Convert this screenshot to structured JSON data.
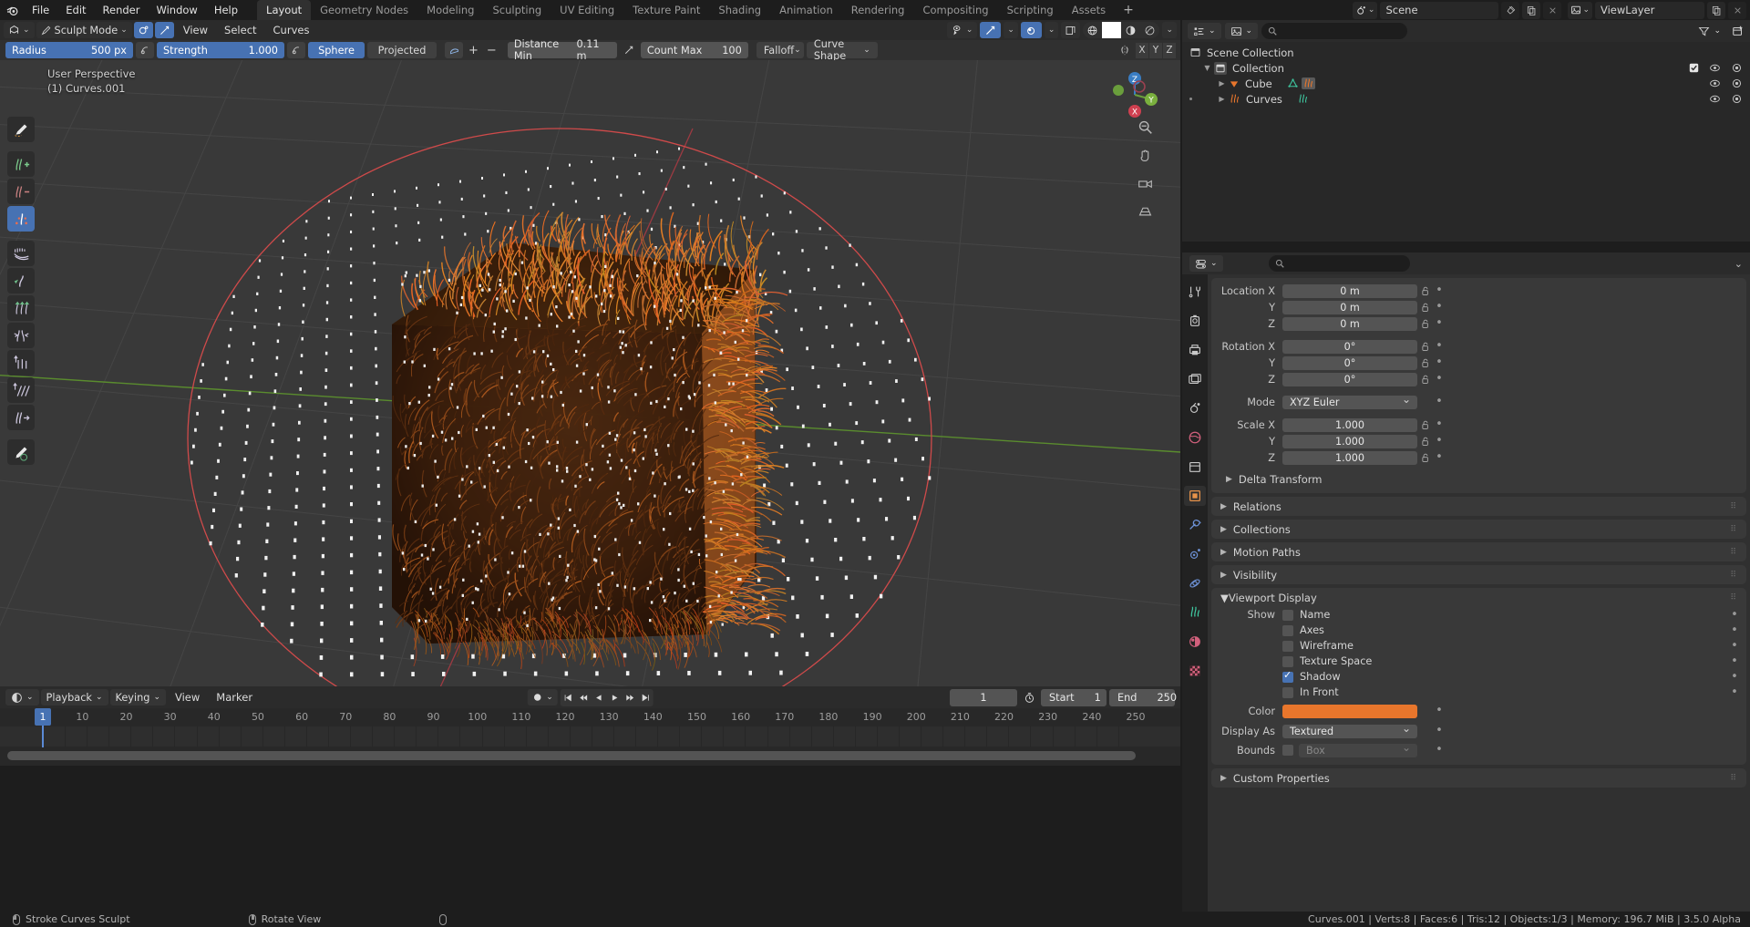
{
  "app": {
    "title": "Blender",
    "logo_icon": "blender-logo-icon"
  },
  "topbar": {
    "menus": [
      "File",
      "Edit",
      "Render",
      "Window",
      "Help"
    ],
    "tabs": [
      "Layout",
      "Geometry Nodes",
      "Modeling",
      "Sculpting",
      "UV Editing",
      "Texture Paint",
      "Shading",
      "Animation",
      "Rendering",
      "Compositing",
      "Scripting",
      "Assets"
    ],
    "active_tab": "Layout",
    "add_workspace_label": "+",
    "scene_icon": "scene-icon",
    "scene_name": "Scene",
    "pin_icon": "pin-icon",
    "copy_icon": "copy-icon",
    "close_icon": "close-icon",
    "viewlayer_icon": "viewlayer-icon",
    "viewlayer_name": "ViewLayer"
  },
  "viewport_header": {
    "editor_type_icon": "editor-type-icon",
    "mode": "Sculpt Mode",
    "toggle_icons": [
      "curves-sculpt-toggle-icon",
      "annotate-icon"
    ],
    "menus": [
      "View",
      "Select",
      "Curves"
    ],
    "right_controls": {
      "visibility_icon": "object-visibility-icon",
      "snap_icon": "snap-magnet-icon",
      "proportional_icon": "proportional-editing-icon",
      "overlay_toggle_icon": "toggle-xray-icon",
      "shading_modes": [
        "wireframe",
        "solid",
        "material",
        "rendered"
      ],
      "shading_active": "solid"
    }
  },
  "tool_settings": {
    "radius_label": "Radius",
    "radius_value": "500 px",
    "radius_pressure_icon": "pressure-icon",
    "strength_label": "Strength",
    "strength_value": "1.000",
    "strength_pressure_icon": "pressure-icon",
    "falloff_shape": "Sphere",
    "projected": "Projected",
    "surface_icon": "surface-icon",
    "plus_label": "+",
    "minus_label": "−",
    "distance_min_label": "Distance Min",
    "distance_min_value": "0.11 m",
    "dm_pressure_icon": "pressure-icon",
    "count_max_label": "Count Max",
    "count_max_value": "100",
    "falloff_label": "Falloff",
    "curve_shape_label": "Curve Shape",
    "mirror_icon": "mirror-icon",
    "axes": [
      "X",
      "Y",
      "Z"
    ]
  },
  "viewport": {
    "perspective_label": "User Perspective",
    "object_label": "(1) Curves.001",
    "gizmo_axes": [
      "Z",
      "Y",
      "X"
    ],
    "nav_icons": [
      "zoom-icon",
      "hand-pan-icon",
      "camera-view-icon",
      "ortho-persp-icon"
    ],
    "tools": [
      {
        "name": "comb-brush-icon",
        "selected": false
      },
      {
        "name": "add-curves-icon",
        "selected": false
      },
      {
        "name": "delete-curves-icon",
        "selected": false
      },
      {
        "name": "density-icon",
        "selected": true
      },
      {
        "name": "comb-icon",
        "selected": false
      },
      {
        "name": "snake-hook-icon",
        "selected": false
      },
      {
        "name": "grow-shrink-icon",
        "selected": false
      },
      {
        "name": "pinch-icon",
        "selected": false
      },
      {
        "name": "puff-icon",
        "selected": false
      },
      {
        "name": "smooth-icon",
        "selected": false
      },
      {
        "name": "slide-icon",
        "selected": false
      },
      {
        "name": "annotate-pencil-icon",
        "selected": false
      }
    ]
  },
  "timeline": {
    "editor_icon": "timeline-editor-icon",
    "menus": [
      "Playback",
      "Keying",
      "View",
      "Marker"
    ],
    "keyframe_type_icon": "keyframe-icon",
    "transport": [
      "jump-start-icon",
      "prev-keyframe-icon",
      "play-reverse-icon",
      "play-icon",
      "next-keyframe-icon",
      "jump-end-icon"
    ],
    "current_frame": "1",
    "timer_icon": "auto-key-icon",
    "start_label": "Start",
    "start_value": "1",
    "end_label": "End",
    "end_value": "250",
    "ruler_ticks": [
      1,
      10,
      20,
      30,
      40,
      50,
      60,
      70,
      80,
      90,
      100,
      110,
      120,
      130,
      140,
      150,
      160,
      170,
      180,
      190,
      200,
      210,
      220,
      230,
      240,
      250
    ],
    "playhead_frame": "1"
  },
  "outliner": {
    "display_mode_icon": "outliner-display-mode-icon",
    "filter_id_icon": "id-type-icon",
    "search_icon": "search-icon",
    "search_placeholder": "",
    "filter_icon": "filter-funnel-icon",
    "new_collection_icon": "new-collection-icon",
    "rows": [
      {
        "label": "Scene Collection",
        "icon": "scene-collection-icon",
        "indent": 0,
        "expand": "",
        "checkbox": false,
        "eye": false,
        "camera": false,
        "active_dot": false,
        "extra_icons": []
      },
      {
        "label": "Collection",
        "icon": "collection-icon",
        "indent": 1,
        "expand": "▼",
        "checkbox": true,
        "eye": true,
        "camera": true,
        "active_dot": false,
        "extra_icons": []
      },
      {
        "label": "Cube",
        "icon": "mesh-data-icon",
        "indent": 2,
        "expand": "▶",
        "checkbox": false,
        "eye": true,
        "camera": true,
        "active_dot": false,
        "extra_icons": [
          "mesh-triangle-icon",
          "curves-modifier-icon"
        ]
      },
      {
        "label": "Curves",
        "icon": "curves-object-icon",
        "indent": 2,
        "expand": "▶",
        "checkbox": false,
        "eye": true,
        "camera": true,
        "active_dot": true,
        "extra_icons": [
          "curves-data-icon"
        ]
      }
    ]
  },
  "properties": {
    "editor_icon": "properties-editor-icon",
    "search_icon": "search-icon",
    "search_placeholder": "",
    "options_icon": "chevron-down-icon",
    "tabs": [
      {
        "name": "tool-tab-icon",
        "active": false
      },
      {
        "name": "render-tab-icon",
        "active": false
      },
      {
        "name": "output-tab-icon",
        "active": false
      },
      {
        "name": "view-layer-tab-icon",
        "active": false
      },
      {
        "name": "scene-tab-icon",
        "active": false
      },
      {
        "name": "world-tab-icon",
        "active": false
      },
      {
        "name": "collection-tab-icon",
        "active": false
      },
      {
        "name": "object-tab-icon",
        "active": true
      },
      {
        "name": "modifier-tab-icon",
        "active": false
      },
      {
        "name": "particles-tab-icon",
        "active": false
      },
      {
        "name": "physics-tab-icon",
        "active": false
      },
      {
        "name": "object-data-tab-icon",
        "active": false
      },
      {
        "name": "material-tab-icon",
        "active": false
      },
      {
        "name": "texture-tab-icon",
        "active": false
      }
    ],
    "transform": {
      "location": {
        "label": "Location X",
        "x": "0 m",
        "y": "0 m",
        "z": "0 m",
        "sub": [
          "Y",
          "Z"
        ]
      },
      "rotation": {
        "label": "Rotation X",
        "x": "0°",
        "y": "0°",
        "z": "0°",
        "sub": [
          "Y",
          "Z"
        ]
      },
      "mode_label": "Mode",
      "mode_value": "XYZ Euler",
      "scale": {
        "label": "Scale X",
        "x": "1.000",
        "y": "1.000",
        "z": "1.000",
        "sub": [
          "Y",
          "Z"
        ]
      },
      "delta_transform": "Delta Transform"
    },
    "panels": [
      "Relations",
      "Collections",
      "Motion Paths",
      "Visibility"
    ],
    "viewport_display": {
      "title": "Viewport Display",
      "show_label": "Show",
      "checkboxes": [
        {
          "label": "Name",
          "checked": false
        },
        {
          "label": "Axes",
          "checked": false
        },
        {
          "label": "Wireframe",
          "checked": false
        },
        {
          "label": "Texture Space",
          "checked": false
        },
        {
          "label": "Shadow",
          "checked": true
        },
        {
          "label": "In Front",
          "checked": false
        }
      ],
      "color_label": "Color",
      "color_value": "#e8762c",
      "display_as_label": "Display As",
      "display_as_value": "Textured",
      "bounds_label": "Bounds",
      "bounds_checked": false,
      "bounds_value": "Box"
    },
    "custom_properties": "Custom Properties"
  },
  "statusbar": {
    "items": [
      {
        "icon": "mouse-left-icon",
        "label": "Stroke Curves Sculpt"
      },
      {
        "icon": "mouse-middle-icon",
        "label": "Rotate View"
      },
      {
        "icon": "mouse-right-icon",
        "label": ""
      }
    ],
    "stats": "Curves.001 | Verts:8 | Faces:6 | Tris:12 | Objects:1/3 | Memory: 196.7 MiB | 3.5.0 Alpha"
  }
}
